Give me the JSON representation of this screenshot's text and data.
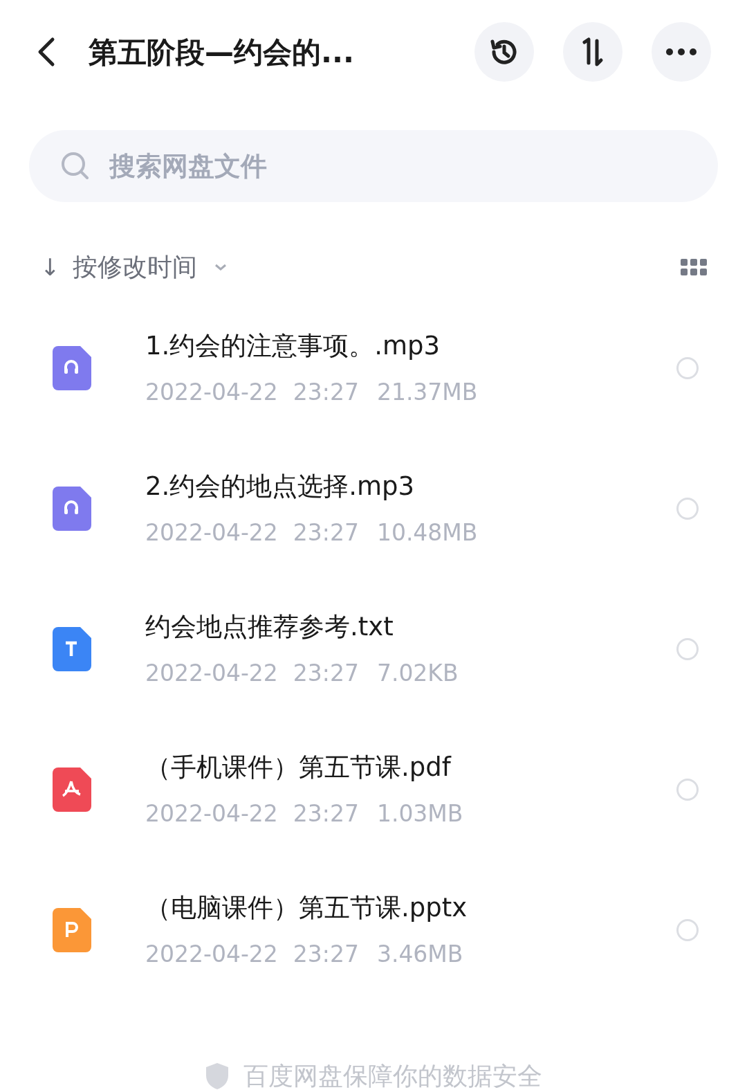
{
  "header": {
    "title": "第五阶段—约会的..."
  },
  "search": {
    "placeholder": "搜索网盘文件"
  },
  "sort": {
    "arrow": "↓",
    "label": "按修改时间"
  },
  "files": [
    {
      "kind": "audio",
      "name": "1.约会的注意事项。.mp3",
      "date": "2022-04-22",
      "time": "23:27",
      "size": "21.37MB",
      "selected": false
    },
    {
      "kind": "audio",
      "name": "2.约会的地点选择.mp3",
      "date": "2022-04-22",
      "time": "23:27",
      "size": "10.48MB",
      "selected": false
    },
    {
      "kind": "text",
      "name": "约会地点推荐参考.txt",
      "date": "2022-04-22",
      "time": "23:27",
      "size": "7.02KB",
      "selected": false
    },
    {
      "kind": "pdf",
      "name": "（手机课件）第五节课.pdf",
      "date": "2022-04-22",
      "time": "23:27",
      "size": "1.03MB",
      "selected": false
    },
    {
      "kind": "ppt",
      "name": "（电脑课件）第五节课.pptx",
      "date": "2022-04-22",
      "time": "23:27",
      "size": "3.46MB",
      "selected": false
    }
  ],
  "footer": {
    "text": "百度网盘保障你的数据安全"
  }
}
